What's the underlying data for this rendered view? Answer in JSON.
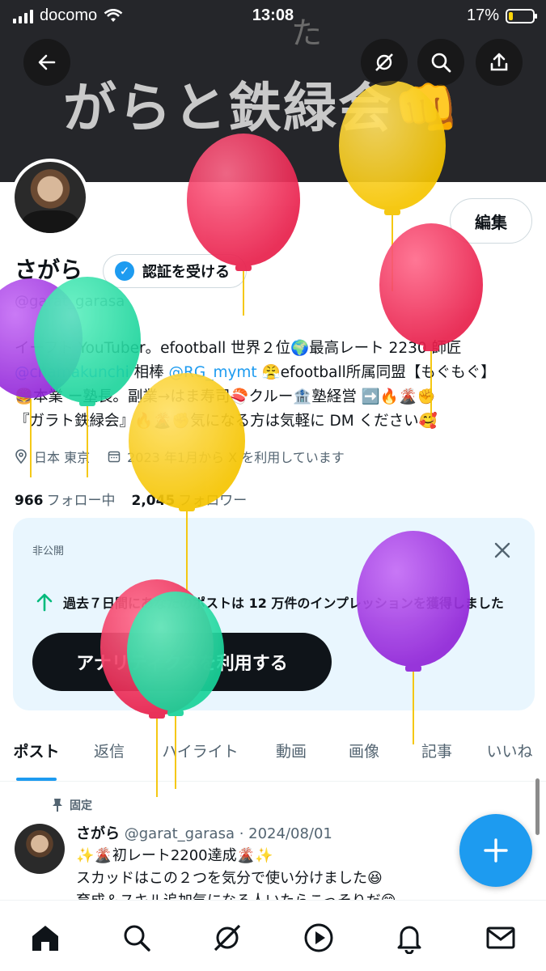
{
  "status": {
    "carrier": "docomo",
    "time": "13:08",
    "battery": "17%",
    "battery_level": 0.17
  },
  "banner": {
    "small_text": "た",
    "title": "がらと鉄緑会👊"
  },
  "header": {
    "back": "back",
    "mute": "mute",
    "search": "search",
    "share": "share"
  },
  "profile": {
    "edit_label": "編集",
    "name": "さがら",
    "verify_label": "認証を受ける",
    "handle": "@garat_garasa",
    "bio_lines": [
      [
        "イーフト YouTuber。efootball 世界２位🌍最高レート 2230 師匠"
      ],
      [
        "@chamakunchi",
        " 相棒 ",
        "@RG_mymt",
        " 😤efootball所属同盟【もぐもぐ】"
      ],
      [
        "🍔本業 ー塾長。副業→はま寿司🍣クルー🏦塾経営 ➡️🔥🌋✊"
      ],
      [
        "『ガラト鉄緑会』🔥🌋✊気になる方は気軽に DM ください🥰"
      ]
    ],
    "location": "日本 東京",
    "joined": "2023 年1月から X を利用しています",
    "following_count": "966",
    "following_label": "フォロー中",
    "followers_count": "2,045",
    "followers_label": "フォロワー"
  },
  "analytics": {
    "label": "非公開",
    "text": "過去７日間にあなたのポストは 12 万件のインプレッションを獲得しました",
    "button": "アナリティクスを利用する"
  },
  "tabs": [
    "ポスト",
    "返信",
    "ハイライト",
    "動画",
    "画像",
    "記事",
    "いいね"
  ],
  "post": {
    "pinned_label": "固定",
    "author": "さがら",
    "handle_date": "@garat_garasa · 2024/08/01",
    "lines": [
      "✨🌋初レート2200達成🌋✨",
      "スカッドはこの２つを気分で使い分けました😆",
      "育成＆スキル追加気になる人いたらこっそりだ😊"
    ]
  },
  "nav": [
    "home",
    "search",
    "grok",
    "video",
    "notifications",
    "messages"
  ],
  "colors": {
    "accent": "#1d9bf0",
    "text": "#0f1419",
    "muted": "#536471",
    "card_bg": "#e9f6fe"
  }
}
